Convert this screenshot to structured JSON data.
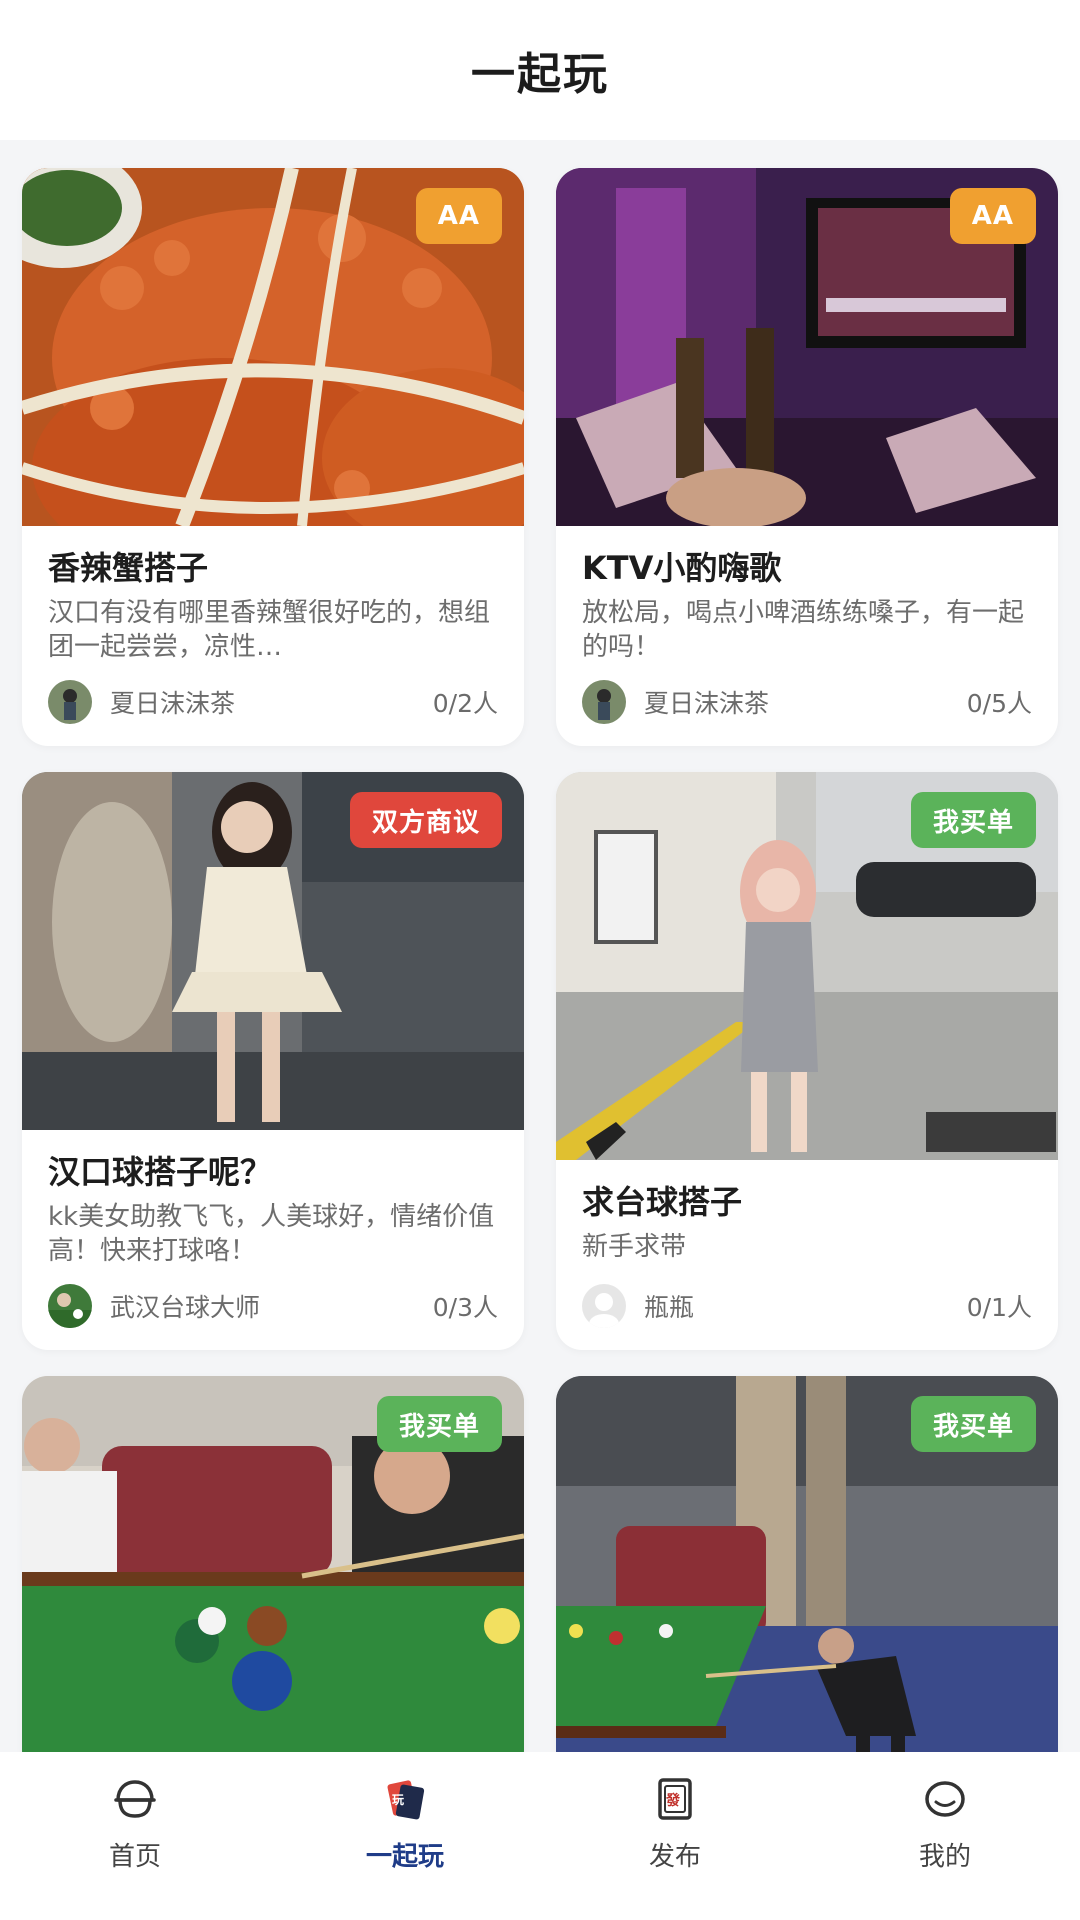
{
  "header": {
    "title": "一起玩"
  },
  "cards": [
    {
      "badge": "AA",
      "badge_color": "#f0a030",
      "title": "香辣蟹搭子",
      "desc": "汉口有没有哪里香辣蟹很好吃的，想组团一起尝尝，凉性…",
      "nickname": "夏日沫沫茶",
      "count": "0/2人"
    },
    {
      "badge": "AA",
      "badge_color": "#f0a030",
      "title": "KTV小酌嗨歌",
      "desc": "放松局，喝点小啤酒练练嗓子，有一起的吗！",
      "nickname": "夏日沫沫茶",
      "count": "0/5人"
    },
    {
      "badge": "双方商议",
      "badge_color": "#e0473c",
      "title": "汉口球搭子呢？",
      "desc": "kk美女助教飞飞，人美球好，情绪价值高！快来打球咯！",
      "nickname": "武汉台球大师",
      "count": "0/3人"
    },
    {
      "badge": "我买单",
      "badge_color": "#5bb35a",
      "title": "求台球搭子",
      "desc": "新手求带",
      "nickname": "瓶瓶",
      "count": "0/1人"
    },
    {
      "badge": "我买单",
      "badge_color": "#5bb35a"
    },
    {
      "badge": "我买单",
      "badge_color": "#5bb35a"
    }
  ],
  "tabbar": {
    "items": [
      {
        "label": "首页",
        "icon": "home-icon"
      },
      {
        "label": "一起玩",
        "icon": "play-together-icon"
      },
      {
        "label": "发布",
        "icon": "publish-icon"
      },
      {
        "label": "我的",
        "icon": "profile-icon"
      }
    ],
    "active_color": "#1f3c88"
  }
}
